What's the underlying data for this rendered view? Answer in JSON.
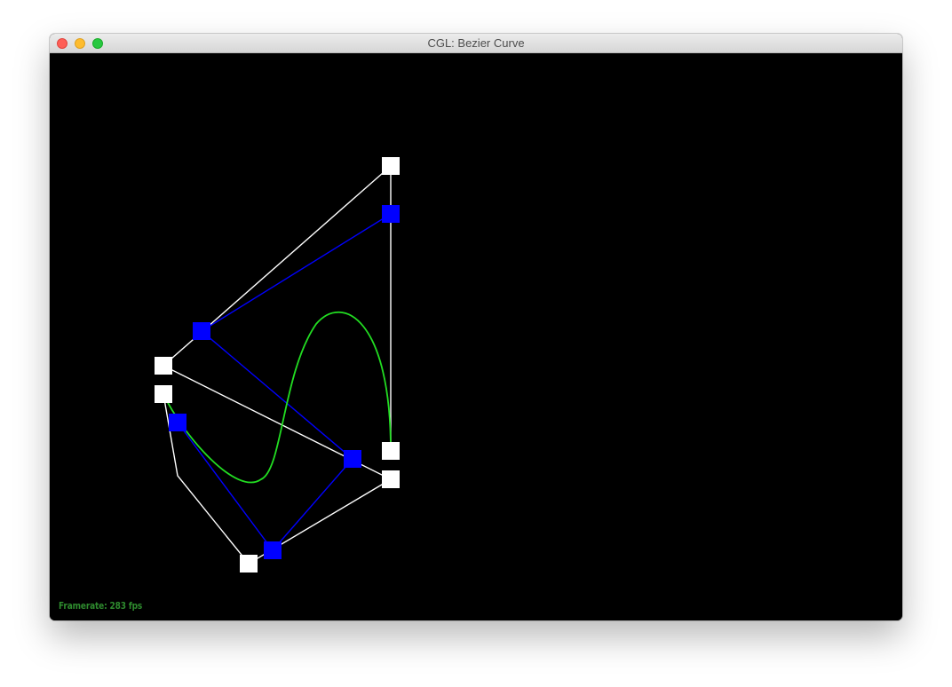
{
  "window": {
    "title": "CGL: Bezier Curve",
    "buttons": {
      "close": "close-button",
      "minimize": "minimize-button",
      "zoom": "zoom-button"
    }
  },
  "status": {
    "framerate_text": "Framerate: 283 fps"
  },
  "colors": {
    "control_polygon": "#ffffff",
    "control_point": "#ffffff",
    "intermediate_polygon": "#0000ff",
    "intermediate_point": "#0000ff",
    "curve": "#22dd22",
    "framerate": "#2e8b2e",
    "background": "#000000"
  }
}
